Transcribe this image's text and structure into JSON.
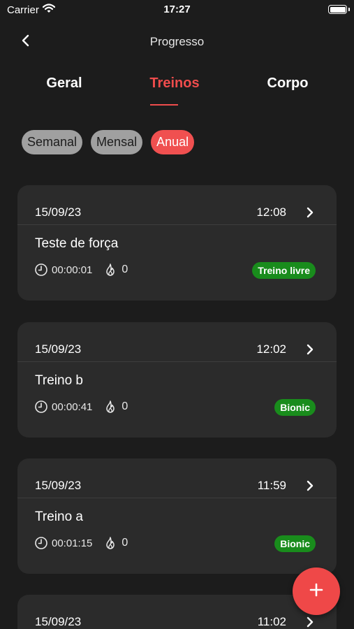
{
  "status_bar": {
    "carrier": "Carrier",
    "time": "17:27"
  },
  "nav": {
    "title": "Progresso"
  },
  "tabs": [
    {
      "label": "Geral",
      "active": false
    },
    {
      "label": "Treinos",
      "active": true
    },
    {
      "label": "Corpo",
      "active": false
    }
  ],
  "periods": [
    {
      "label": "Semanal",
      "active": false
    },
    {
      "label": "Mensal",
      "active": false
    },
    {
      "label": "Anual",
      "active": true
    }
  ],
  "workouts": [
    {
      "date": "15/09/23",
      "time": "12:08",
      "name": "Teste de força",
      "duration": "00:00:01",
      "kcal": "0",
      "tag": "Treino livre"
    },
    {
      "date": "15/09/23",
      "time": "12:02",
      "name": "Treino b",
      "duration": "00:00:41",
      "kcal": "0",
      "tag": "Bionic"
    },
    {
      "date": "15/09/23",
      "time": "11:59",
      "name": "Treino a",
      "duration": "00:01:15",
      "kcal": "0",
      "tag": "Bionic"
    },
    {
      "date": "15/09/23",
      "time": "11:02"
    }
  ],
  "colors": {
    "accent": "#ef4c4c",
    "tag_green": "#198c1c",
    "card": "#2b2b2b",
    "background": "#1c1c1c"
  },
  "icons": {
    "back": "chevron-left-icon",
    "wifi": "wifi-icon",
    "battery": "battery-icon",
    "clock": "clock-icon",
    "flame": "flame-icon",
    "row": "chevron-right-icon",
    "fab": "plus-icon"
  }
}
